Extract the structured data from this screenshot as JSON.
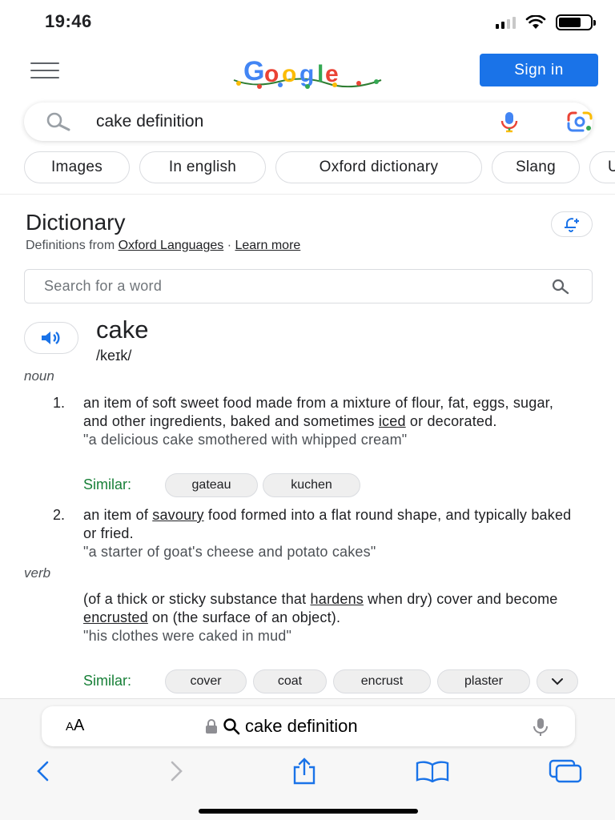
{
  "status_bar": {
    "time": "19:46"
  },
  "header": {
    "sign_in_label": "Sign in",
    "logo_alt": "Google"
  },
  "search": {
    "query": "cake definition"
  },
  "chips": [
    "Images",
    "In english",
    "Oxford dictionary",
    "Slang",
    "U"
  ],
  "dictionary": {
    "title": "Dictionary",
    "source_prefix": "Definitions from ",
    "source_link": "Oxford Languages",
    "separator": " · ",
    "learn_more": "Learn more",
    "search_placeholder": "Search for a word",
    "word": "cake",
    "phonetic": "/keɪk/",
    "noun_label": "noun",
    "verb_label": "verb",
    "def1_number": "1.",
    "def1_text_a": "an item of soft sweet food made from a mixture of flour, fat, eggs, sugar, and other ingredients, baked and sometimes ",
    "def1_link": "iced",
    "def1_text_b": " or decorated.",
    "def1_example": "\"a delicious cake smothered with whipped cream\"",
    "similar_label": "Similar:",
    "def1_similar": [
      "gateau",
      "kuchen"
    ],
    "def2_number": "2.",
    "def2_text_a": "an item of ",
    "def2_link": "savoury",
    "def2_text_b": " food formed into a flat round shape, and typically baked or fried.",
    "def2_example": "\"a starter of goat's cheese and potato cakes\"",
    "verb_text_a": "(of a thick or sticky substance that ",
    "verb_link1": "hardens",
    "verb_text_b": " when dry) cover and become ",
    "verb_link2": "encrusted",
    "verb_text_c": " on (the surface of an object).",
    "verb_example": "\"his clothes were caked in mud\"",
    "verb_similar": [
      "cover",
      "coat",
      "encrust",
      "plaster"
    ]
  },
  "safari": {
    "aa_big": "A",
    "aa_small": "A",
    "url_text": "cake definition"
  },
  "colors": {
    "accent": "#1a73e8",
    "similar_green": "#188038"
  }
}
